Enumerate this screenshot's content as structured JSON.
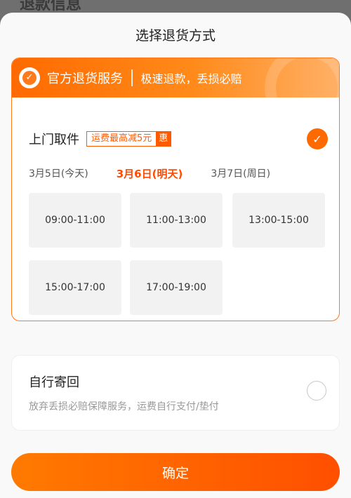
{
  "background_title": "退款信息",
  "sheet": {
    "title": "选择退货方式"
  },
  "official": {
    "badge_icon_glyph": "✓",
    "name": "官方退货服务",
    "desc": "极速退款，丢损必赔"
  },
  "pickup": {
    "title": "上门取件",
    "promo_text": "运费最高减5元",
    "promo_tag": "惠",
    "selected": true,
    "check_glyph": "✓",
    "dates": [
      {
        "label": "3月5日(今天)",
        "active": false
      },
      {
        "label": "3月6日(明天)",
        "active": true
      },
      {
        "label": "3月7日(周日)",
        "active": false
      }
    ],
    "slots": [
      "09:00-11:00",
      "11:00-13:00",
      "13:00-15:00",
      "15:00-17:00",
      "17:00-19:00"
    ]
  },
  "self_return": {
    "title": "自行寄回",
    "desc": "放弃丢损必赔保障服务，运费自行支付/垫付",
    "selected": false
  },
  "confirm_label": "确定",
  "colors": {
    "accent": "#ff6a00",
    "accent_dark": "#ff4a00",
    "slot_bg": "#f2f2f2"
  }
}
